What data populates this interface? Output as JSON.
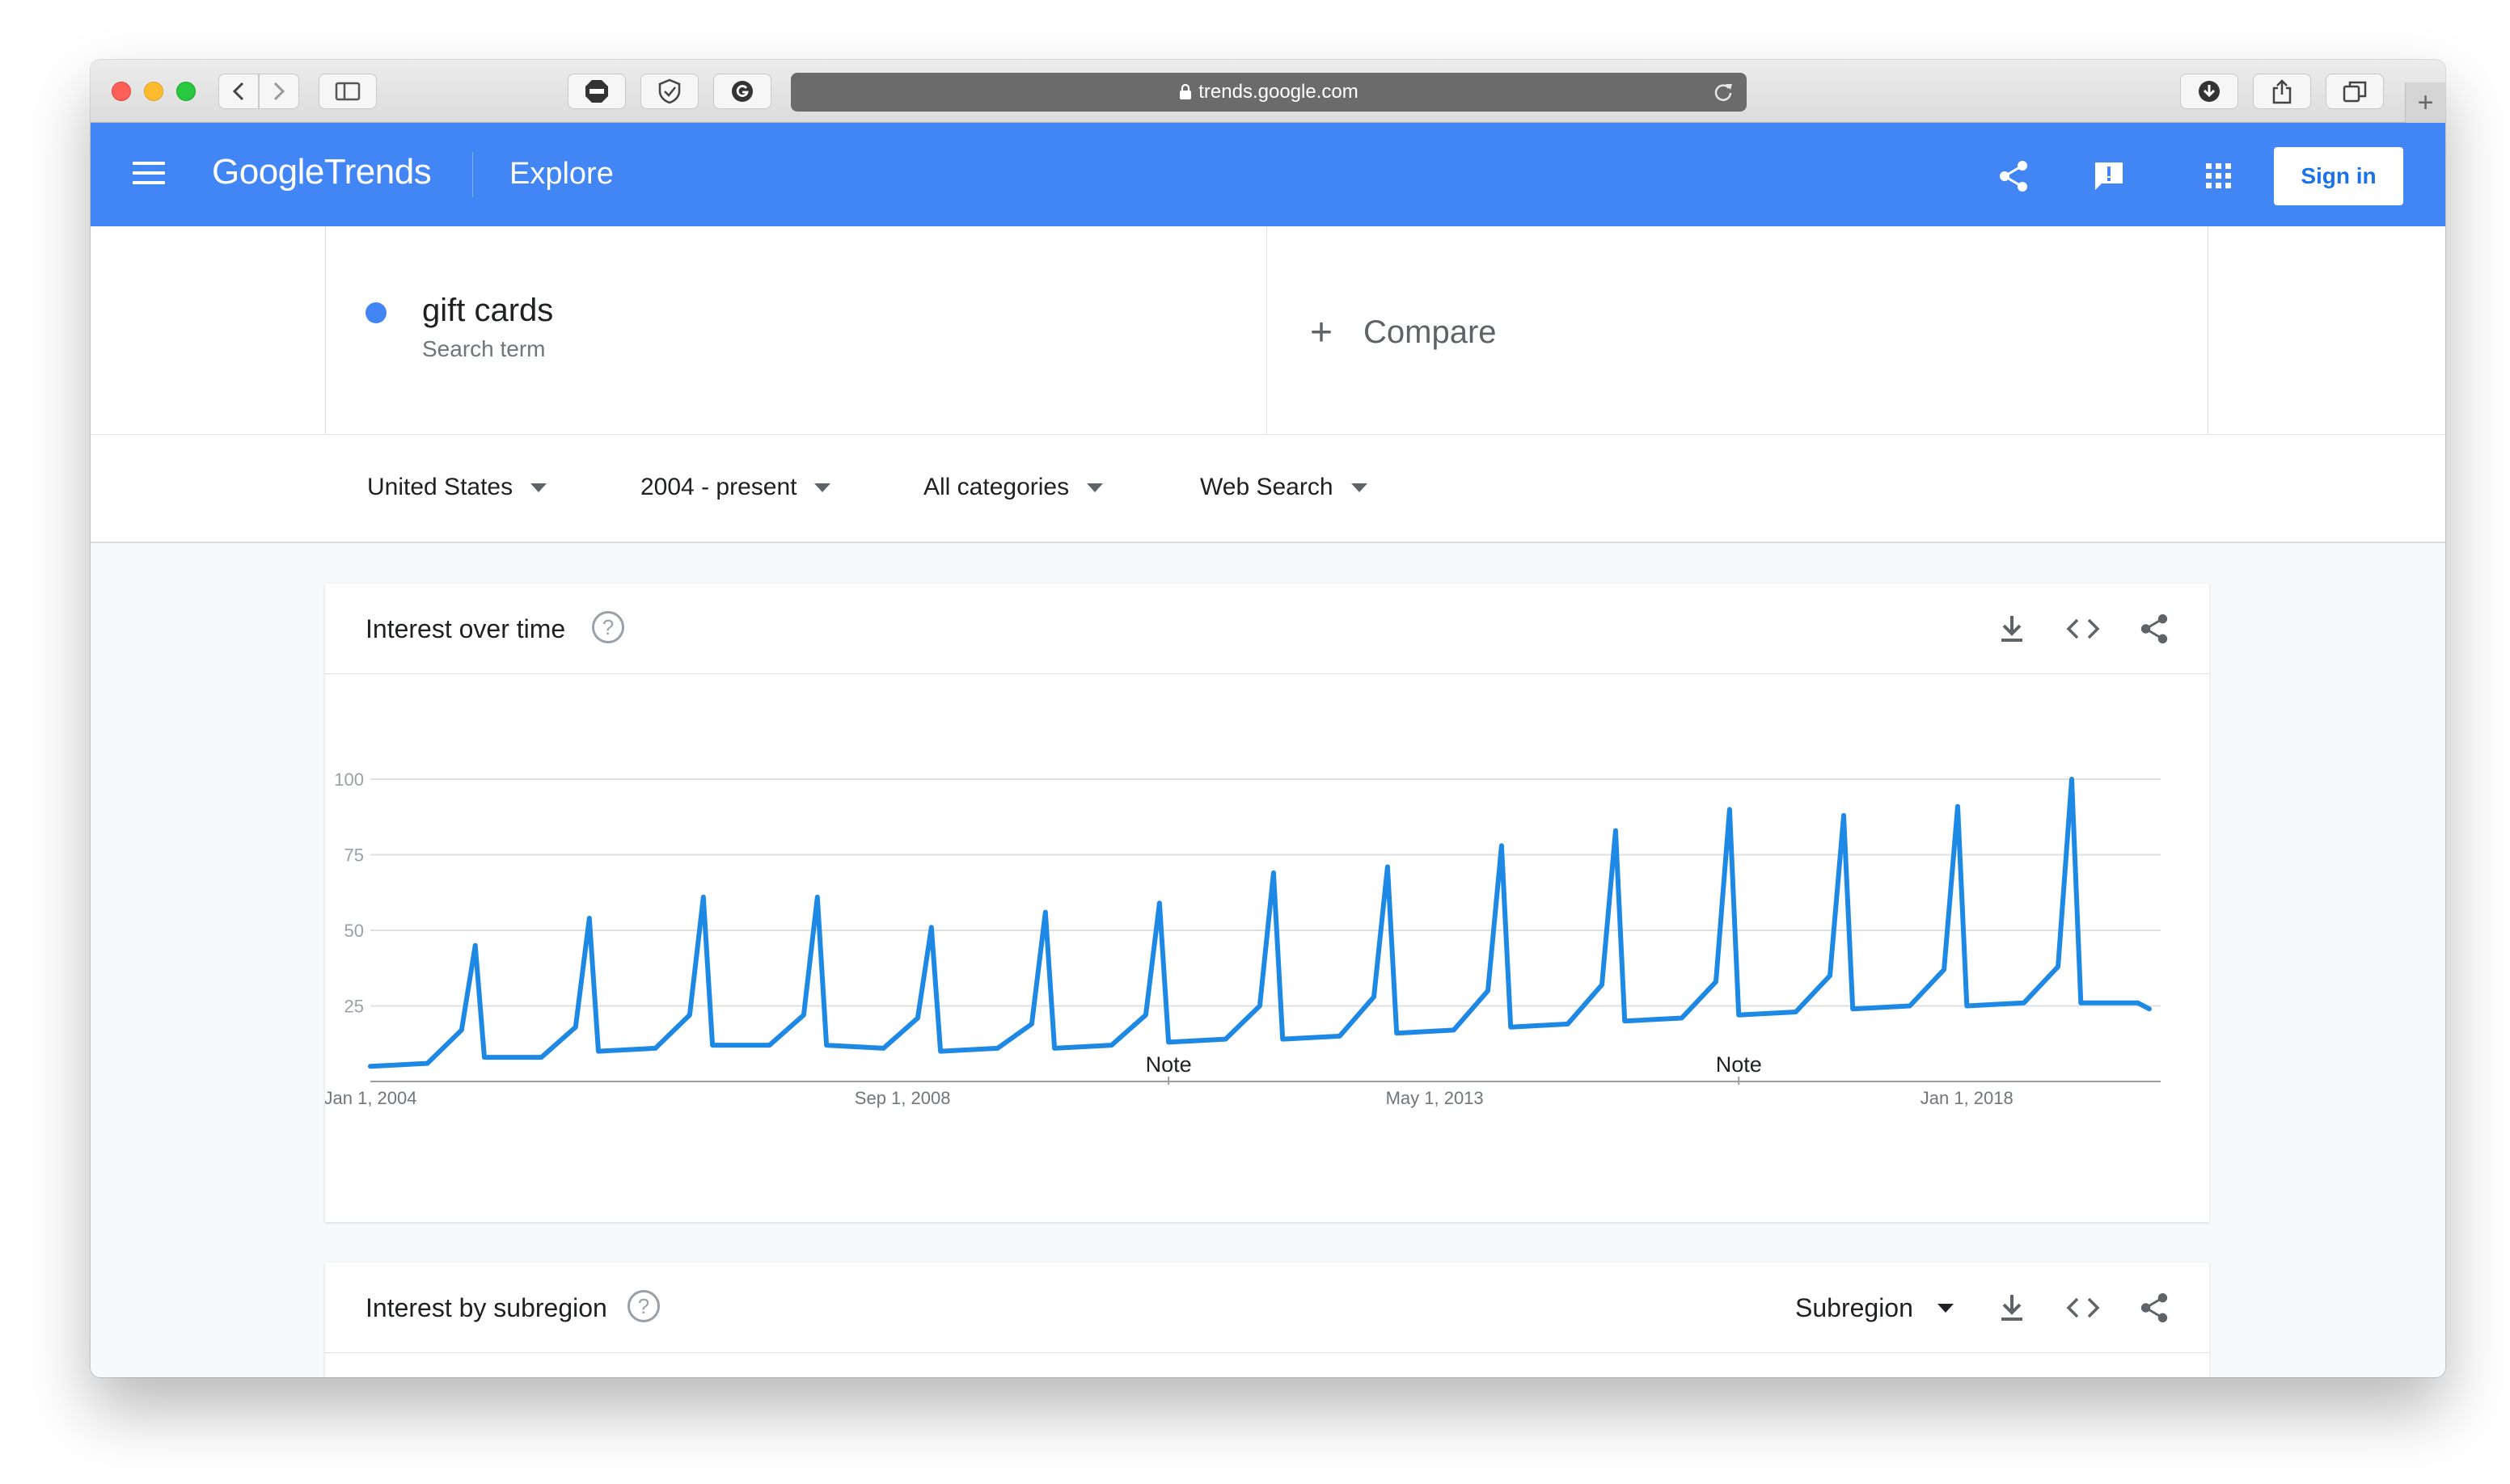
{
  "browser": {
    "url": "trends.google.com",
    "new_tab": "+"
  },
  "header": {
    "logo_google": "Google",
    "logo_trends": "Trends",
    "section": "Explore",
    "sign_in": "Sign in"
  },
  "term": {
    "name": "gift cards",
    "type": "Search term",
    "color": "#4285f4"
  },
  "compare": {
    "plus": "+",
    "label": "Compare"
  },
  "filters": {
    "region": "United States",
    "time": "2004 - present",
    "category": "All categories",
    "search_type": "Web Search"
  },
  "interest_over_time": {
    "title": "Interest over time",
    "help": "?"
  },
  "interest_by_subregion": {
    "title": "Interest by subregion",
    "help": "?",
    "selector": "Subregion"
  },
  "chart_data": {
    "type": "line",
    "series": [
      {
        "color": "#1e88e5",
        "x": [
          2004.0,
          2004.5,
          2004.8,
          2004.92,
          2005.0,
          2005.5,
          2005.8,
          2005.92,
          2006.0,
          2006.5,
          2006.8,
          2006.92,
          2007.0,
          2007.5,
          2007.8,
          2007.92,
          2008.0,
          2008.5,
          2008.8,
          2008.92,
          2009.0,
          2009.5,
          2009.8,
          2009.92,
          2010.0,
          2010.5,
          2010.8,
          2010.92,
          2011.0,
          2011.5,
          2011.8,
          2011.92,
          2012.0,
          2012.5,
          2012.8,
          2012.92,
          2013.0,
          2013.5,
          2013.8,
          2013.92,
          2014.0,
          2014.5,
          2014.8,
          2014.92,
          2015.0,
          2015.5,
          2015.8,
          2015.92,
          2016.0,
          2016.5,
          2016.8,
          2016.92,
          2017.0,
          2017.5,
          2017.8,
          2017.92,
          2018.0,
          2018.5,
          2018.8,
          2018.92,
          2019.0,
          2019.5,
          2019.6
        ],
        "values": [
          5,
          6,
          17,
          45,
          8,
          8,
          18,
          54,
          10,
          11,
          22,
          61,
          12,
          12,
          22,
          61,
          12,
          11,
          21,
          51,
          10,
          11,
          19,
          56,
          11,
          12,
          22,
          59,
          13,
          14,
          25,
          69,
          14,
          15,
          28,
          71,
          16,
          17,
          30,
          78,
          18,
          19,
          32,
          83,
          20,
          21,
          33,
          90,
          22,
          23,
          35,
          88,
          24,
          25,
          37,
          91,
          25,
          26,
          38,
          100,
          26,
          26,
          24
        ]
      }
    ],
    "x_ticks": [
      "Jan 1, 2004",
      "Sep 1, 2008",
      "May 1, 2013",
      "Jan 1, 2018"
    ],
    "x_tick_values": [
      2004.0,
      2008.667,
      2013.333,
      2018.0
    ],
    "y_ticks": [
      25,
      50,
      75,
      100
    ],
    "ylim": [
      0,
      100
    ],
    "xlim": [
      2004.0,
      2019.7
    ],
    "annotations": [
      {
        "label": "Note",
        "x": 2011.0
      },
      {
        "label": "Note",
        "x": 2016.0
      }
    ],
    "grid": true
  }
}
